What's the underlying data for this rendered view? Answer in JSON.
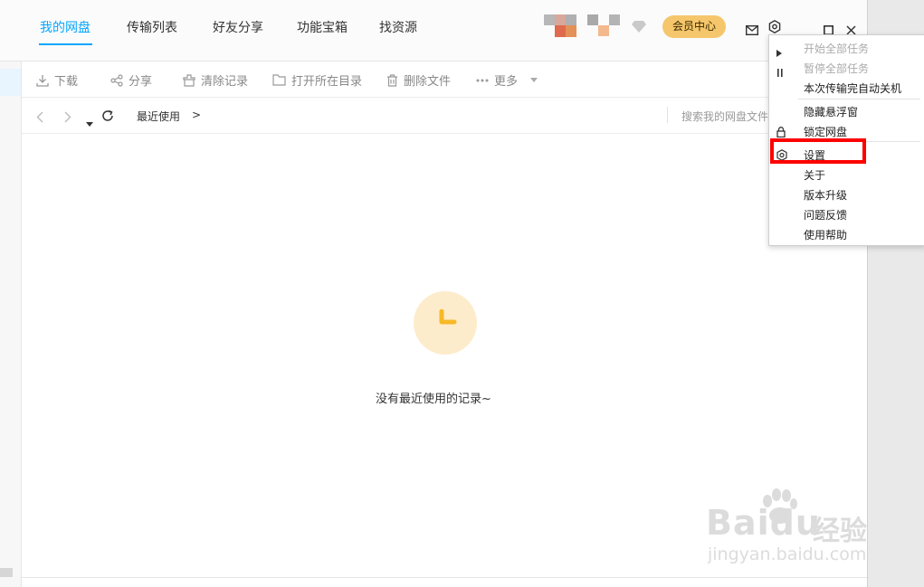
{
  "tabs": [
    {
      "label": "我的网盘",
      "active": true
    },
    {
      "label": "传输列表",
      "active": false
    },
    {
      "label": "好友分享",
      "active": false
    },
    {
      "label": "功能宝箱",
      "active": false
    },
    {
      "label": "找资源",
      "active": false
    }
  ],
  "header": {
    "vip_label": "会员中心",
    "icons": [
      "diamond-icon",
      "mail-icon",
      "settings-icon",
      "minimize-icon",
      "maximize-icon",
      "close-icon"
    ]
  },
  "toolbar": {
    "items": [
      {
        "label": "下载",
        "icon": "download-icon"
      },
      {
        "label": "分享",
        "icon": "share-icon"
      },
      {
        "label": "清除记录",
        "icon": "clear-icon"
      },
      {
        "label": "打开所在目录",
        "icon": "folder-icon"
      },
      {
        "label": "删除文件",
        "icon": "trash-icon"
      },
      {
        "label": "更多",
        "icon": "more-icon"
      }
    ]
  },
  "nav": {
    "breadcrumb": "最近使用",
    "breadcrumb_sep": ">",
    "search_placeholder": "搜索我的网盘文件"
  },
  "empty_state": {
    "message": "没有最近使用的记录~",
    "icon": "clock-icon",
    "accent": "#fdeccb",
    "icon_color": "#f7b928"
  },
  "menu": {
    "items": [
      {
        "label": "开始全部任务",
        "disabled": true,
        "icon": "play-icon"
      },
      {
        "label": "暂停全部任务",
        "disabled": true,
        "icon": "pause-icon"
      },
      {
        "label": "本次传输完自动关机",
        "disabled": false,
        "icon": ""
      },
      {
        "label": "隐藏悬浮窗",
        "disabled": false,
        "icon": ""
      },
      {
        "label": "锁定网盘",
        "disabled": false,
        "icon": "lock-icon"
      },
      {
        "label": "设置",
        "disabled": false,
        "icon": "settings-icon"
      },
      {
        "label": "关于",
        "disabled": false,
        "icon": ""
      },
      {
        "label": "版本升级",
        "disabled": false,
        "icon": ""
      },
      {
        "label": "问题反馈",
        "disabled": false,
        "icon": ""
      },
      {
        "label": "使用帮助",
        "disabled": false,
        "icon": ""
      }
    ]
  },
  "watermark": {
    "brand": "Baidu",
    "cn": "经验",
    "url": "jingyan.baidu.com"
  },
  "colors": {
    "accent": "#06a7ff",
    "vip": "#f5c66b",
    "highlight": "#ff0000"
  }
}
